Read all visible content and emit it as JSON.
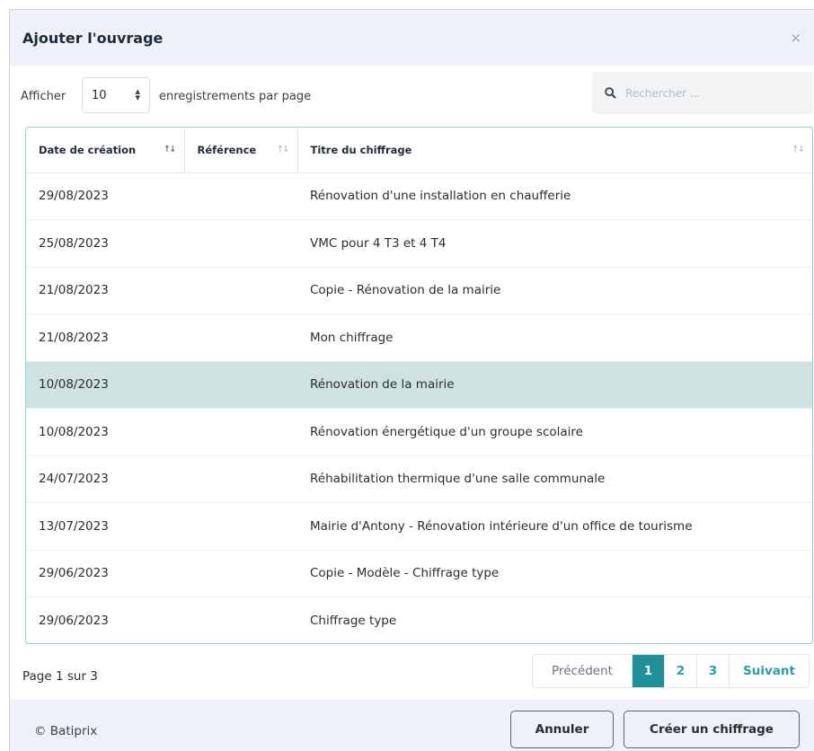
{
  "modal": {
    "title": "Ajouter l'ouvrage",
    "close_label": "×"
  },
  "toolbar": {
    "show_label": "Afficher",
    "length_value": "10",
    "per_page_label": "enregistrements par page",
    "search_placeholder": "Rechercher ..."
  },
  "table": {
    "columns": [
      "Date de création",
      "Référence",
      "Titre du chiffrage"
    ],
    "rows": [
      {
        "date": "29/08/2023",
        "reference": "",
        "title": "Rénovation d'une installation en chaufferie"
      },
      {
        "date": "25/08/2023",
        "reference": "",
        "title": "VMC pour 4 T3 et 4 T4"
      },
      {
        "date": "21/08/2023",
        "reference": "",
        "title": "Copie - Rénovation de la mairie"
      },
      {
        "date": "21/08/2023",
        "reference": "",
        "title": "Mon chiffrage"
      },
      {
        "date": "10/08/2023",
        "reference": "",
        "title": "Rénovation de la mairie"
      },
      {
        "date": "10/08/2023",
        "reference": "",
        "title": "Rénovation énergétique d'un groupe scolaire"
      },
      {
        "date": "24/07/2023",
        "reference": "",
        "title": "Réhabilitation thermique d'une salle communale"
      },
      {
        "date": "13/07/2023",
        "reference": "",
        "title": "Mairie d'Antony - Rénovation intérieure d'un office de tourisme"
      },
      {
        "date": "29/06/2023",
        "reference": "",
        "title": "Copie - Modèle - Chiffrage type"
      },
      {
        "date": "29/06/2023",
        "reference": "",
        "title": "Chiffrage type"
      }
    ],
    "selected_index": 4
  },
  "pagination": {
    "info": "Page 1 sur 3",
    "previous": "Précédent",
    "pages": [
      "1",
      "2",
      "3"
    ],
    "current": "1",
    "next": "Suivant"
  },
  "footer": {
    "copyright": "© Batiprix",
    "cancel_label": "Annuler",
    "create_label": "Créer un chiffrage"
  },
  "colors": {
    "accent": "#1f8f99",
    "selected_row": "#cfe2e2",
    "header_bg": "#eef2f8"
  }
}
